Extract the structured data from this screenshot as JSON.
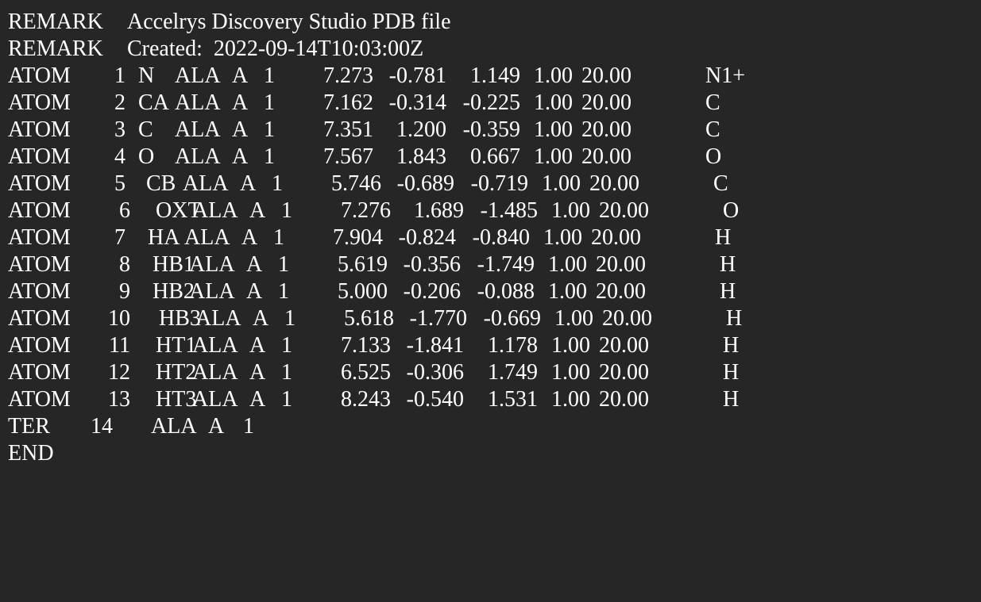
{
  "document": {
    "remarks": [
      {
        "record": "REMARK",
        "text": "Accelrys Discovery Studio PDB file"
      },
      {
        "record": "REMARK",
        "text": "Created:  2022-09-14T10:03:00Z"
      }
    ],
    "atoms": [
      {
        "record": "ATOM",
        "serial": "1",
        "name": "N",
        "resname": "ALA",
        "chain": "A",
        "resseq": "1",
        "x": "7.273",
        "y": "-0.781",
        "z": "1.149",
        "occupancy": "1.00",
        "bfactor": "20.00",
        "element": "N1+"
      },
      {
        "record": "ATOM",
        "serial": "2",
        "name": "CA",
        "resname": "ALA",
        "chain": "A",
        "resseq": "1",
        "x": "7.162",
        "y": "-0.314",
        "z": "-0.225",
        "occupancy": "1.00",
        "bfactor": "20.00",
        "element": "C"
      },
      {
        "record": "ATOM",
        "serial": "3",
        "name": "C",
        "resname": "ALA",
        "chain": "A",
        "resseq": "1",
        "x": "7.351",
        "y": "1.200",
        "z": "-0.359",
        "occupancy": "1.00",
        "bfactor": "20.00",
        "element": "C"
      },
      {
        "record": "ATOM",
        "serial": "4",
        "name": "O",
        "resname": "ALA",
        "chain": "A",
        "resseq": "1",
        "x": "7.567",
        "y": "1.843",
        "z": "0.667",
        "occupancy": "1.00",
        "bfactor": "20.00",
        "element": "O"
      },
      {
        "record": "ATOM",
        "serial": "5",
        "name": "CB",
        "resname": "ALA",
        "chain": "A",
        "resseq": "1",
        "x": "5.746",
        "y": "-0.689",
        "z": "-0.719",
        "occupancy": "1.00",
        "bfactor": "20.00",
        "element": "C"
      },
      {
        "record": "ATOM",
        "serial": "6",
        "name": "OXT",
        "resname": "ALA",
        "chain": "A",
        "resseq": "1",
        "x": "7.276",
        "y": "1.689",
        "z": "-1.485",
        "occupancy": "1.00",
        "bfactor": "20.00",
        "element": "O"
      },
      {
        "record": "ATOM",
        "serial": "7",
        "name": "HA",
        "resname": "ALA",
        "chain": "A",
        "resseq": "1",
        "x": "7.904",
        "y": "-0.824",
        "z": "-0.840",
        "occupancy": "1.00",
        "bfactor": "20.00",
        "element": "H"
      },
      {
        "record": "ATOM",
        "serial": "8",
        "name": "HB1",
        "resname": "ALA",
        "chain": "A",
        "resseq": "1",
        "x": "5.619",
        "y": "-0.356",
        "z": "-1.749",
        "occupancy": "1.00",
        "bfactor": "20.00",
        "element": "H"
      },
      {
        "record": "ATOM",
        "serial": "9",
        "name": "HB2",
        "resname": "ALA",
        "chain": "A",
        "resseq": "1",
        "x": "5.000",
        "y": "-0.206",
        "z": "-0.088",
        "occupancy": "1.00",
        "bfactor": "20.00",
        "element": "H"
      },
      {
        "record": "ATOM",
        "serial": "10",
        "name": "HB3",
        "resname": "ALA",
        "chain": "A",
        "resseq": "1",
        "x": "5.618",
        "y": "-1.770",
        "z": "-0.669",
        "occupancy": "1.00",
        "bfactor": "20.00",
        "element": "H"
      },
      {
        "record": "ATOM",
        "serial": "11",
        "name": "HT1",
        "resname": "ALA",
        "chain": "A",
        "resseq": "1",
        "x": "7.133",
        "y": "-1.841",
        "z": "1.178",
        "occupancy": "1.00",
        "bfactor": "20.00",
        "element": "H"
      },
      {
        "record": "ATOM",
        "serial": "12",
        "name": "HT2",
        "resname": "ALA",
        "chain": "A",
        "resseq": "1",
        "x": "6.525",
        "y": "-0.306",
        "z": "1.749",
        "occupancy": "1.00",
        "bfactor": "20.00",
        "element": "H"
      },
      {
        "record": "ATOM",
        "serial": "13",
        "name": "HT3",
        "resname": "ALA",
        "chain": "A",
        "resseq": "1",
        "x": "8.243",
        "y": "-0.540",
        "z": "1.531",
        "occupancy": "1.00",
        "bfactor": "20.00",
        "element": "H"
      }
    ],
    "ter": {
      "record": "TER",
      "serial": "14",
      "resname": "ALA",
      "chain": "A",
      "resseq": "1"
    },
    "end": {
      "record": "END"
    }
  },
  "colors": {
    "background": "#262626",
    "text": "#ffffff"
  }
}
